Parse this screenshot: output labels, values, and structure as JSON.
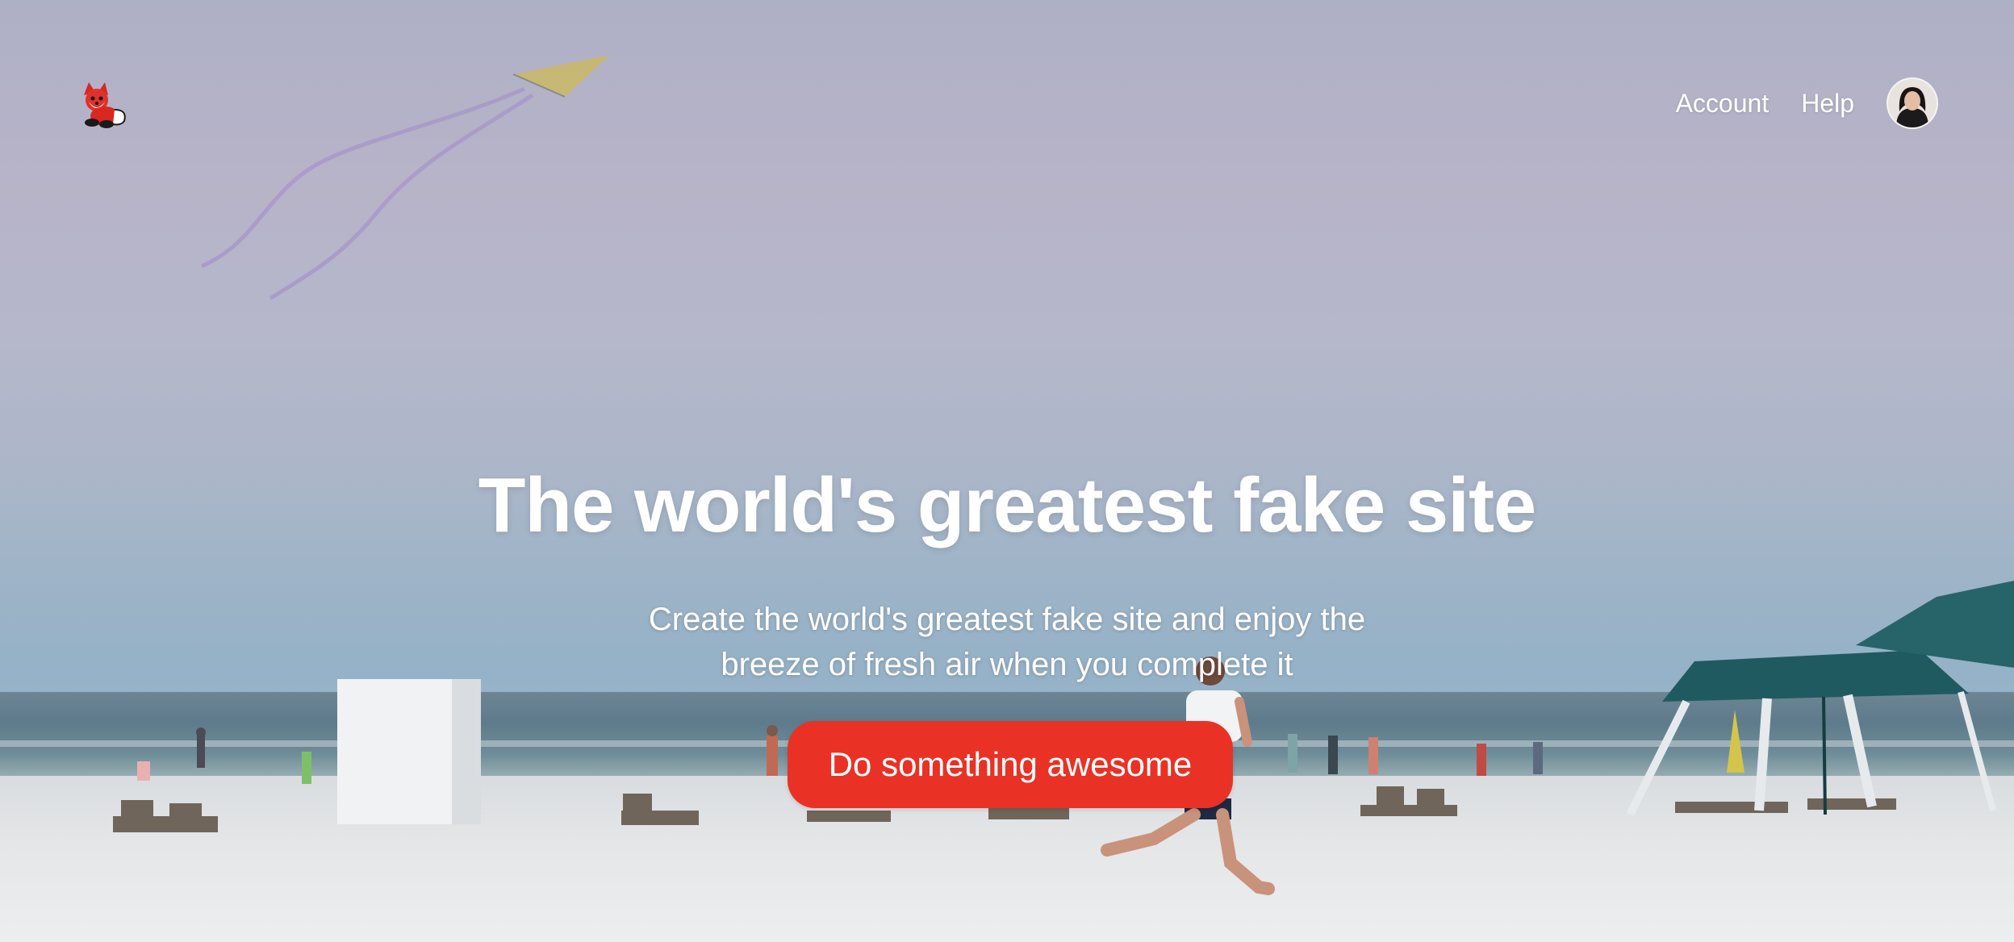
{
  "header": {
    "logo_icon": "fox-mascot-logo",
    "nav": {
      "account_label": "Account",
      "help_label": "Help"
    },
    "avatar_icon": "user-avatar"
  },
  "hero": {
    "title": "The world's greatest fake site",
    "subtitle": "Create the world's greatest fake site and enjoy the breeze of fresh air when you complete it",
    "cta_label": "Do something awesome"
  },
  "colors": {
    "cta_background": "#e93225",
    "text": "#ffffff"
  }
}
